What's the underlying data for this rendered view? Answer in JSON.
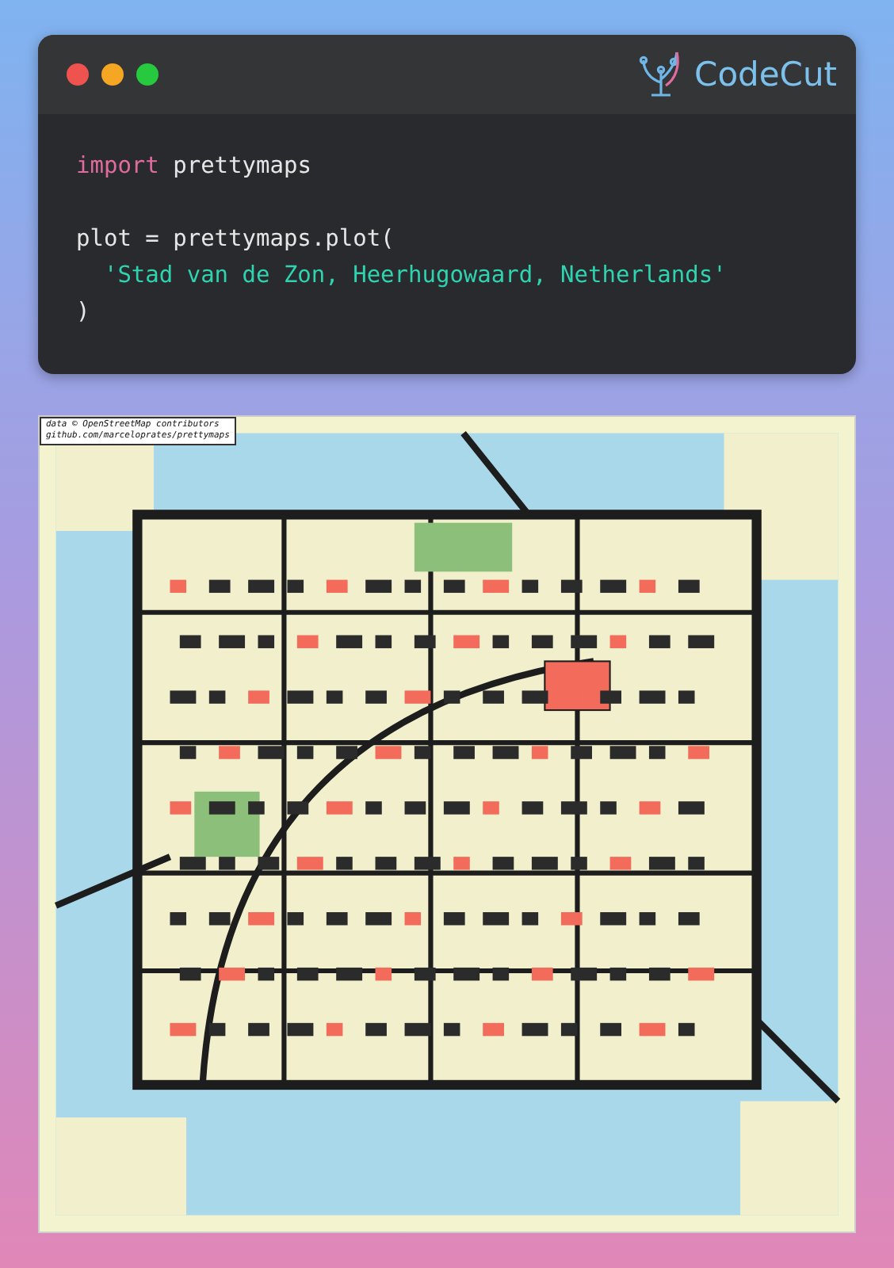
{
  "code_window": {
    "traffic_lights": [
      {
        "color": "#ef5350"
      },
      {
        "color": "#f5a623"
      },
      {
        "color": "#27c93f"
      }
    ],
    "brand": "CodeCut",
    "code_blocks": [
      [
        [
          {
            "kind": "keyword",
            "text": "import"
          },
          {
            "kind": "plain",
            "text": " prettymaps"
          }
        ]
      ],
      [
        [
          {
            "kind": "plain",
            "text": "plot = prettymaps.plot("
          }
        ],
        [
          {
            "kind": "string",
            "text": "  'Stad van de Zon, Heerhugowaard, Netherlands'"
          }
        ],
        [
          {
            "kind": "plain",
            "text": ")"
          }
        ]
      ]
    ]
  },
  "map": {
    "attribution": [
      "data © OpenStreetMap contributors",
      "github.com/marceloprates/prettymaps"
    ]
  }
}
